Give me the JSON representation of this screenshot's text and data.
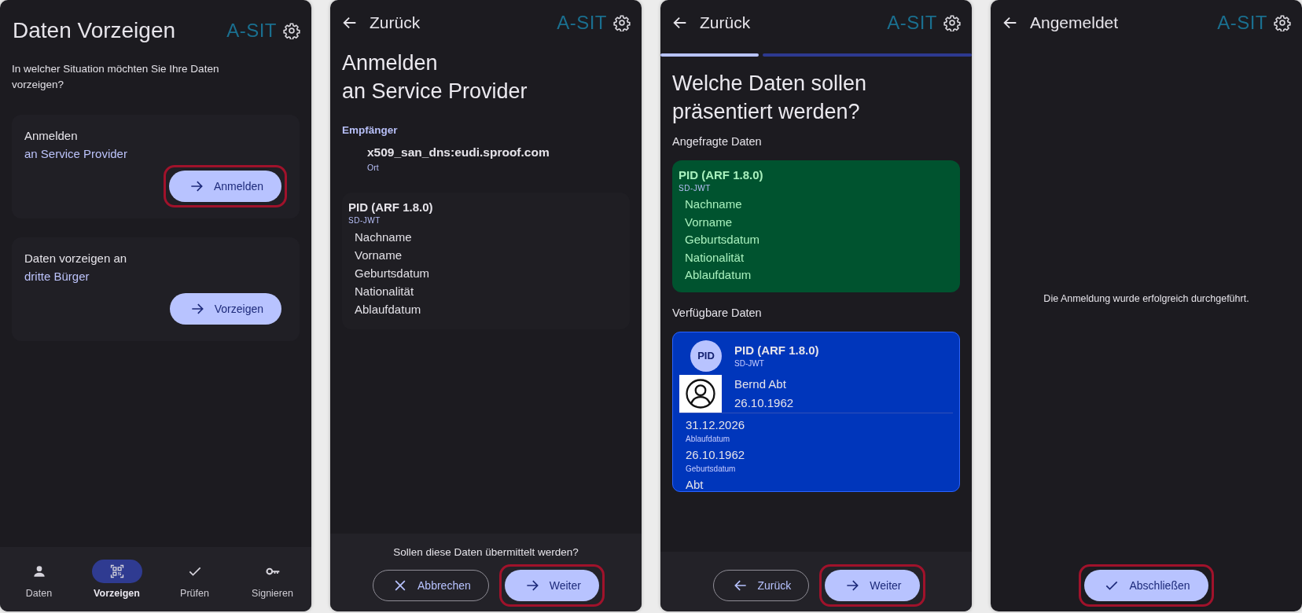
{
  "screens": [
    {
      "kind": "menu",
      "header": {
        "title": "Daten Vorzeigen",
        "back": false,
        "logo": "A-SIT"
      },
      "intro": "In welcher Situation möchten Sie Ihre Daten vorzeigen?",
      "cards": [
        {
          "title": "Anmelden",
          "subtitle": "an Service Provider",
          "button": {
            "label": "Anmelden",
            "kind": "next",
            "highlighted": true
          }
        },
        {
          "title": "Daten vorzeigen an",
          "subtitle": "dritte Bürger",
          "button": {
            "label": "Vorzeigen",
            "kind": "next",
            "highlighted": false
          }
        }
      ],
      "nav": [
        {
          "label": "Daten",
          "selected": false
        },
        {
          "label": "Vorzeigen",
          "selected": true
        },
        {
          "label": "Prüfen",
          "selected": false
        },
        {
          "label": "Signieren",
          "selected": false
        }
      ]
    },
    {
      "kind": "consent",
      "header": {
        "title": "Zurück",
        "back": true,
        "logo": "A-SIT"
      },
      "heading": [
        "Anmelden",
        "an Service Provider"
      ],
      "recipient": {
        "label": "Empfänger",
        "value": "x509_san_dns:eudi.sproof.com",
        "sublabel": "Ort"
      },
      "credential": {
        "name": "PID (ARF 1.8.0)",
        "format": "SD-JWT",
        "attributes": [
          "Nachname",
          "Vorname",
          "Geburtsdatum",
          "Nationalität",
          "Ablaufdatum"
        ]
      },
      "footer": {
        "question": "Sollen diese Daten übermittelt werden?",
        "buttons": [
          {
            "label": "Abbrechen",
            "kind": "cancel",
            "highlighted": false
          },
          {
            "label": "Weiter",
            "kind": "next",
            "highlighted": true
          }
        ]
      }
    },
    {
      "kind": "select",
      "header": {
        "title": "Zurück",
        "back": true,
        "logo": "A-SIT"
      },
      "progress": [
        {
          "done": true
        },
        {
          "done": false
        }
      ],
      "heading": [
        "Welche Daten sollen",
        "präsentiert werden?"
      ],
      "requested_label": "Angefragte Daten",
      "requested": {
        "name": "PID (ARF 1.8.0)",
        "format": "SD-JWT",
        "attributes": [
          "Nachname",
          "Vorname",
          "Geburtsdatum",
          "Nationalität",
          "Ablaufdatum"
        ]
      },
      "available_label": "Verfügbare Daten",
      "available": {
        "badge": "PID",
        "name": "PID (ARF 1.8.0)",
        "format": "SD-JWT",
        "holder_name": "Bernd Abt",
        "holder_birth_date": "26.10.1962",
        "fields": [
          {
            "value": "31.12.2026",
            "label": "Ablaufdatum"
          },
          {
            "value": "26.10.1962",
            "label": "Geburtsdatum"
          },
          {
            "value": "Abt"
          }
        ]
      },
      "footer": {
        "buttons": [
          {
            "label": "Zurück",
            "kind": "back",
            "highlighted": false
          },
          {
            "label": "Weiter",
            "kind": "next",
            "highlighted": true
          }
        ]
      }
    },
    {
      "kind": "done",
      "header": {
        "title": "Angemeldet",
        "back": true,
        "logo": "A-SIT"
      },
      "message": "Die Anmeldung wurde erfolgreich durchgeführt.",
      "footer": {
        "buttons": [
          {
            "label": "Abschließen",
            "kind": "finish",
            "highlighted": true
          }
        ]
      }
    }
  ]
}
